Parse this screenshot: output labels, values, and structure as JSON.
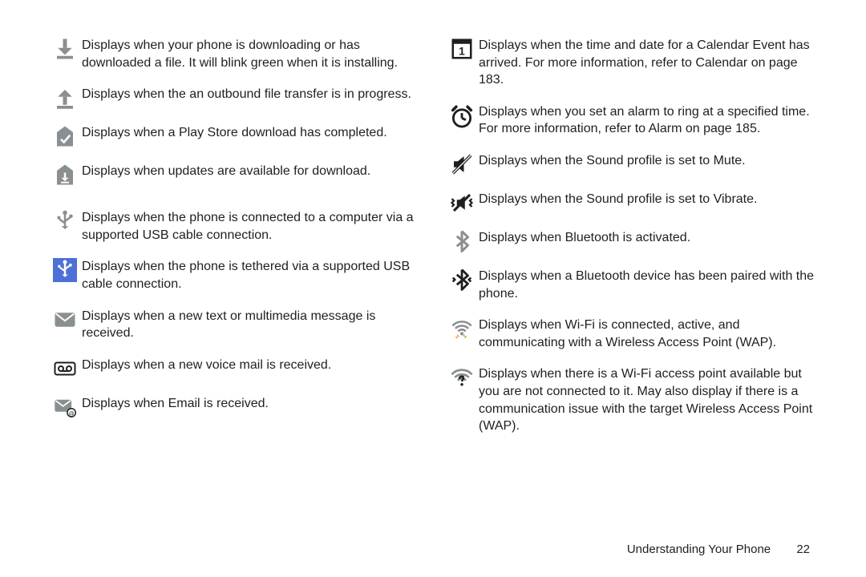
{
  "left": [
    "Displays when your phone is downloading or has downloaded a file. It will blink green when it is installing.",
    "Displays when the an outbound file transfer is in progress.",
    "Displays when a Play Store download has completed.",
    "Displays when updates are available for download.",
    "Displays when the phone is connected to a computer via a supported USB cable connection.",
    "Displays when the phone is tethered via a supported USB cable connection.",
    "Displays when a new text or multimedia message is received.",
    "Displays when a new voice mail is received.",
    "Displays when Email is received."
  ],
  "right": [
    "Displays when the time and date for a Calendar Event has arrived. For more information, refer to  Calendar  on page 183.",
    "Displays when you set an alarm to ring at a specified time. For more information, refer to  Alarm  on page 185.",
    "Displays when the Sound profile is set to Mute.",
    "Displays when the Sound profile is set to Vibrate.",
    "Displays when Bluetooth is activated.",
    "Displays when a Bluetooth device has been paired with the phone.",
    "Displays when Wi-Fi is connected, active, and communicating with a Wireless Access Point (WAP).",
    "Displays when there is a Wi-Fi access point available but you are not connected to it. May also display if there is a communication issue with the target Wireless Access Point (WAP)."
  ],
  "footer": {
    "section": "Understanding Your Phone",
    "page": "22"
  }
}
